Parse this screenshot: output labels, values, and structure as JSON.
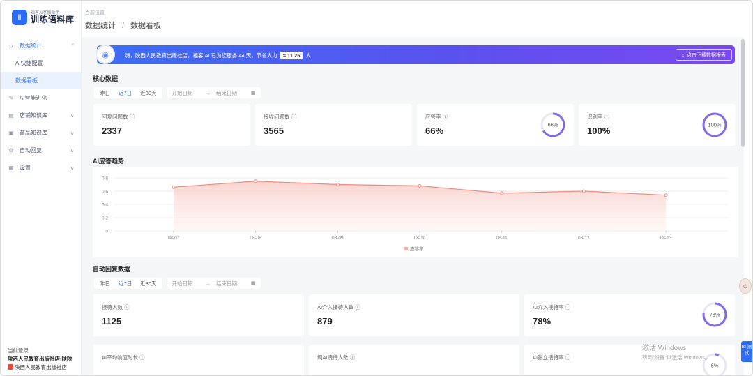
{
  "logo": {
    "icon": "waveform-icon",
    "subtitle": "福客AI客服助手",
    "title": "训练语料库"
  },
  "sidebar": {
    "items": [
      {
        "label": "数据统计",
        "icon": "home-icon",
        "open": true,
        "chevron": "^"
      },
      {
        "label": "AI快捷配置",
        "sub": true
      },
      {
        "label": "数据看板",
        "sub": true,
        "active": true
      },
      {
        "label": "AI智能进化",
        "icon": "wand-icon"
      },
      {
        "label": "店铺知识库",
        "icon": "document-icon",
        "chevron": "∨"
      },
      {
        "label": "商品知识库",
        "icon": "box-icon",
        "chevron": "∨"
      },
      {
        "label": "自动回复",
        "icon": "reply-icon",
        "chevron": "∨"
      },
      {
        "label": "设置",
        "icon": "grid-icon",
        "chevron": "∨"
      }
    ],
    "login": {
      "label": "当前登录",
      "account": "陕西人民教育出版社店:陕陕",
      "org": "陕西人民教育出版社店"
    }
  },
  "header": {
    "location_label": "当前位置",
    "crumb1": "数据统计",
    "sep": "/",
    "crumb2": "数据看板"
  },
  "banner": {
    "text_before": "嗨，陕西人民教育出版社店，福客 AI 已为您服务 44 天，节省人力",
    "number": "≈ 11.25",
    "text_after": "人",
    "button": "点击下载数据报表",
    "button_icon": "download-icon"
  },
  "core": {
    "title": "核心数据",
    "filters": [
      "昨日",
      "近7日",
      "近30天"
    ],
    "active_filter": "近7日",
    "start_placeholder": "开始日期",
    "arrow": "→",
    "end_placeholder": "结束日期",
    "cards": [
      {
        "label": "回复问题数 ⓘ",
        "value": "2337"
      },
      {
        "label": "接收问题数 ⓘ",
        "value": "3565"
      },
      {
        "label": "应答率 ⓘ",
        "value": "66%",
        "ring": 66,
        "ring_label": "66%"
      },
      {
        "label": "识别率 ⓘ",
        "value": "100%",
        "ring": 100,
        "ring_label": "100%"
      }
    ]
  },
  "trend": {
    "title": "AI应答趋势"
  },
  "chart_data": {
    "type": "area",
    "x": [
      "08-07",
      "08-08",
      "08-09",
      "08-10",
      "08-11",
      "08-12",
      "08-13"
    ],
    "series": [
      {
        "name": "应答率",
        "values": [
          0.66,
          0.75,
          0.7,
          0.68,
          0.57,
          0.6,
          0.54
        ]
      }
    ],
    "yticks": [
      "0",
      "0.2",
      "0.4",
      "0.6",
      "0.8"
    ],
    "ylim": [
      0,
      0.8
    ],
    "grid": true,
    "legend": "bottom-center",
    "color": "#f08a7e"
  },
  "auto": {
    "title": "自动回复数据",
    "filters": [
      "昨日",
      "近7日",
      "近30天"
    ],
    "active_filter": "近7日",
    "start_placeholder": "开始日期",
    "arrow": "→",
    "end_placeholder": "结束日期",
    "cards": [
      {
        "label": "接待人数 ⓘ",
        "value": "1125"
      },
      {
        "label": "AI介入接待人数 ⓘ",
        "value": "879"
      },
      {
        "label": "AI介入接待率 ⓘ",
        "value": "78%",
        "ring": 78,
        "ring_label": "78%"
      },
      {
        "label": "AI平均响应时长 ⓘ",
        "value": ""
      },
      {
        "label": "纯AI接待人数 ⓘ",
        "value": ""
      },
      {
        "label": "AI独立接待率 ⓘ",
        "value": "",
        "ring": 6,
        "ring_label": "6%"
      }
    ]
  },
  "floating": {
    "tab_text": "BI 测试"
  },
  "watermark": {
    "line1": "激活 Windows",
    "line2": "转到“设置”以激活 Windows。"
  }
}
